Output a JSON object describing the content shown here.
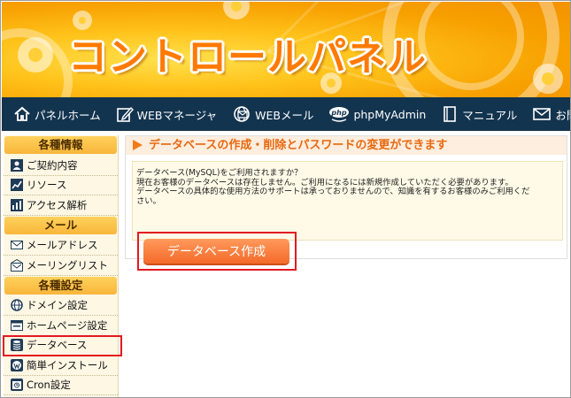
{
  "banner": {
    "title": "コントロールパネル"
  },
  "nav": {
    "items": [
      {
        "label": "パネルホーム",
        "icon": "home-icon"
      },
      {
        "label": "WEBマネージャ",
        "icon": "edit-icon"
      },
      {
        "label": "WEBメール",
        "icon": "web-mail-icon"
      },
      {
        "label": "phpMyAdmin",
        "icon": "php-icon",
        "icon_text": "php"
      },
      {
        "label": "マニュアル",
        "icon": "manual-icon"
      },
      {
        "label": "お問い合わせ",
        "icon": "mail-icon"
      }
    ]
  },
  "sidebar": {
    "sections": [
      {
        "title": "各種情報",
        "items": [
          {
            "label": "ご契約内容",
            "icon": "user-icon"
          },
          {
            "label": "リソース",
            "icon": "chart-icon"
          },
          {
            "label": "アクセス解析",
            "icon": "analytics-icon"
          }
        ]
      },
      {
        "title": "メール",
        "items": [
          {
            "label": "メールアドレス",
            "icon": "envelope-icon"
          },
          {
            "label": "メーリングリスト",
            "icon": "mailing-list-icon"
          }
        ]
      },
      {
        "title": "各種設定",
        "items": [
          {
            "label": "ドメイン設定",
            "icon": "globe-icon"
          },
          {
            "label": "ホームページ設定",
            "icon": "homepage-icon"
          },
          {
            "label": "データベース",
            "icon": "database-icon",
            "highlighted": true
          },
          {
            "label": "簡単インストール",
            "icon": "wordpress-icon"
          },
          {
            "label": "Cron設定",
            "icon": "cron-icon"
          }
        ]
      }
    ]
  },
  "main": {
    "heading": "データベースの作成・削除とパスワードの変更ができます",
    "info_lines": [
      "データベース(MySQL)をご利用されますか？",
      "現在お客様のデータベースは存在しません。ご利用になるには新規作成していただく必要があります。",
      "データベースの具体的な使用方法のサポートは承っておりませんので、知識を有するお客様のみご利用くだ",
      "さい。"
    ],
    "create_button": "データベース作成"
  },
  "colors": {
    "nav_bg": "#13344f",
    "accent_orange": "#f46a2a",
    "highlight_red": "#e3191f",
    "section_header": "#f8b63a"
  }
}
